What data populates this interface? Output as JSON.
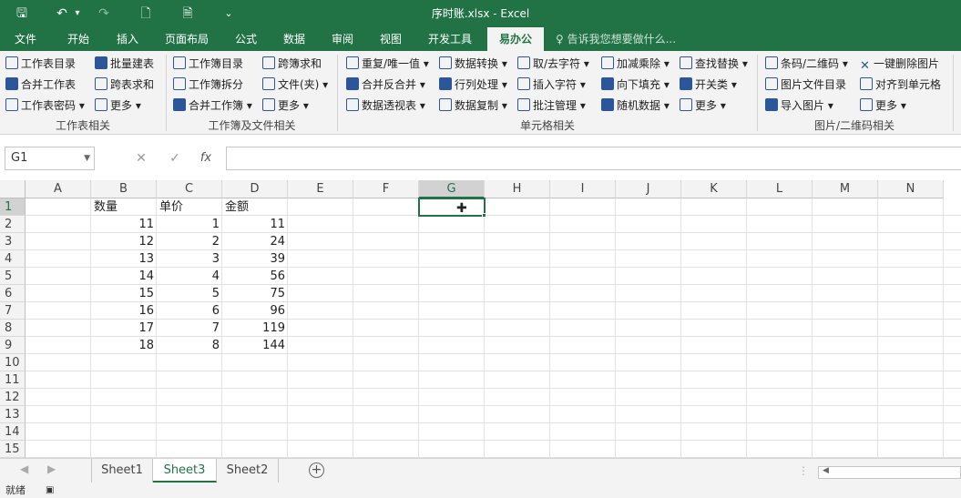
{
  "window": {
    "title": "序时账.xlsx - Excel"
  },
  "qat": {
    "save": "🖫",
    "undo": "↶",
    "undo_drop": "▾",
    "redo": "↷",
    "preview": "🗋",
    "newdoc": "🗎",
    "custom": "⌄"
  },
  "tabs": [
    {
      "label": "文件"
    },
    {
      "label": "开始"
    },
    {
      "label": "插入"
    },
    {
      "label": "页面布局"
    },
    {
      "label": "公式"
    },
    {
      "label": "数据"
    },
    {
      "label": "审阅"
    },
    {
      "label": "视图"
    },
    {
      "label": "开发工具"
    },
    {
      "label": "易办公"
    }
  ],
  "tellme": "♀ 告诉我您想要做什么...",
  "ribbon": {
    "g1": {
      "label": "工作表相关",
      "items": [
        "工作表目录",
        "批量建表",
        "合并工作表",
        "跨表求和",
        "工作表密码 ▾",
        "更多 ▾"
      ]
    },
    "g2": {
      "label": "工作簿及文件相关",
      "items": [
        "工作簿目录",
        "跨簿求和",
        "工作簿拆分",
        "文件(夹) ▾",
        "合并工作簿 ▾",
        "更多 ▾"
      ]
    },
    "g3": {
      "label": "单元格相关",
      "items": [
        "重复/唯一值 ▾",
        "数据转换 ▾",
        "取/去字符 ▾",
        "加减乘除 ▾",
        "查找替换 ▾",
        "合并反合并 ▾",
        "行列处理 ▾",
        "插入字符 ▾",
        "向下填充 ▾",
        "开关类 ▾",
        "数据透视表 ▾",
        "数据复制 ▾",
        "批注管理 ▾",
        "随机数据 ▾",
        "更多 ▾"
      ]
    },
    "g4": {
      "label": "图片/二维码相关",
      "items": [
        "条码/二维码 ▾",
        "一键删除图片",
        "图片文件目录",
        "对齐到单元格",
        "导入图片 ▾",
        "更多 ▾"
      ]
    }
  },
  "formula": {
    "namebox": "G1",
    "cancel": "✕",
    "enter": "✓",
    "fx": "fx"
  },
  "columns": [
    "A",
    "B",
    "C",
    "D",
    "E",
    "F",
    "G",
    "H",
    "I",
    "J",
    "K",
    "L",
    "M",
    "N"
  ],
  "rows": [
    "1",
    "2",
    "3",
    "4",
    "5",
    "6",
    "7",
    "8",
    "9",
    "10",
    "11",
    "12",
    "13",
    "14",
    "15"
  ],
  "headers": {
    "B": "数量",
    "C": "单价",
    "D": "金额"
  },
  "data": [
    {
      "b": "11",
      "c": "1",
      "d": "11"
    },
    {
      "b": "12",
      "c": "2",
      "d": "24"
    },
    {
      "b": "13",
      "c": "3",
      "d": "39"
    },
    {
      "b": "14",
      "c": "4",
      "d": "56"
    },
    {
      "b": "15",
      "c": "5",
      "d": "75"
    },
    {
      "b": "16",
      "c": "6",
      "d": "96"
    },
    {
      "b": "17",
      "c": "7",
      "d": "119"
    },
    {
      "b": "18",
      "c": "8",
      "d": "144"
    }
  ],
  "selected_cell": "G1",
  "sheets": [
    {
      "label": "Sheet1"
    },
    {
      "label": "Sheet3"
    },
    {
      "label": "Sheet2"
    }
  ],
  "active_sheet": "Sheet3",
  "sheet_add": "+",
  "status": {
    "ready": "就绪",
    "macro": "▣"
  },
  "accent": "#217346"
}
